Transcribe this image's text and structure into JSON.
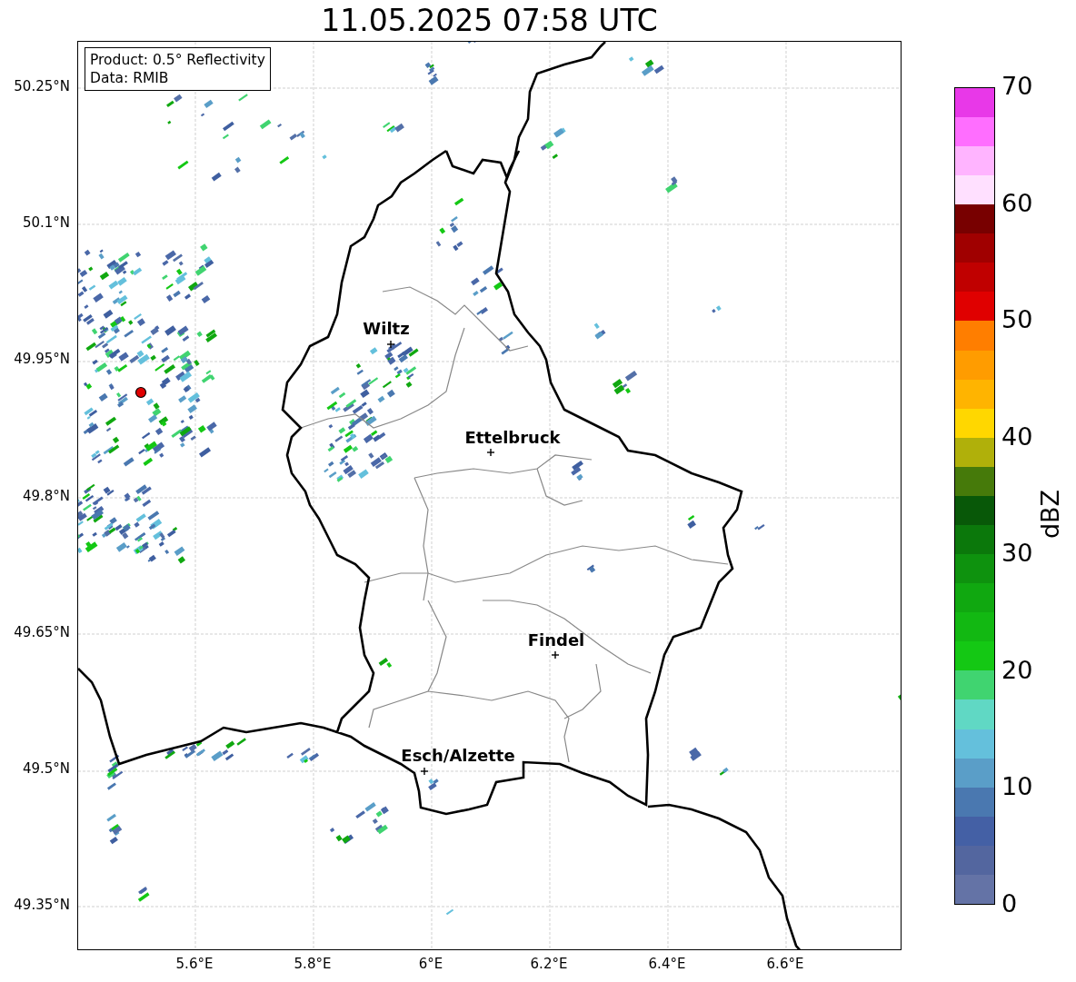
{
  "title": "11.05.2025 07:58 UTC",
  "info_box": {
    "lines": [
      "Product: 0.5° Reflectivity",
      "Data: RMIB"
    ]
  },
  "map": {
    "yticks": [
      "50.25°N",
      "50.1°N",
      "49.95°N",
      "49.8°N",
      "49.65°N",
      "49.5°N",
      "49.35°N"
    ],
    "xticks": [
      "5.6°E",
      "5.8°E",
      "6°E",
      "6.2°E",
      "6.4°E",
      "6.6°E"
    ],
    "cities": [
      {
        "name": "Wiltz"
      },
      {
        "name": "Ettelbruck"
      },
      {
        "name": "Findel"
      },
      {
        "name": "Esch/Alzette"
      }
    ]
  },
  "colorbar": {
    "label": "dBZ",
    "ticks": [
      "70",
      "60",
      "50",
      "40",
      "30",
      "20",
      "10",
      "0"
    ],
    "bins": [
      {
        "color": "#6473a6"
      },
      {
        "color": "#53669f"
      },
      {
        "color": "#4460a5"
      },
      {
        "color": "#4a78b0"
      },
      {
        "color": "#5a9ec8"
      },
      {
        "color": "#64c0dc"
      },
      {
        "color": "#60d8c4"
      },
      {
        "color": "#40d470"
      },
      {
        "color": "#14c814"
      },
      {
        "color": "#12b812"
      },
      {
        "color": "#10a810"
      },
      {
        "color": "#0e920e"
      },
      {
        "color": "#0b780b"
      },
      {
        "color": "#085808"
      },
      {
        "color": "#467a0a"
      },
      {
        "color": "#b0b00a"
      },
      {
        "color": "#ffd700"
      },
      {
        "color": "#ffb400"
      },
      {
        "color": "#ff9c00"
      },
      {
        "color": "#ff7e00"
      },
      {
        "color": "#e00000"
      },
      {
        "color": "#c00000"
      },
      {
        "color": "#a00000"
      },
      {
        "color": "#780000"
      },
      {
        "color": "#ffe0ff"
      },
      {
        "color": "#ffb4ff"
      },
      {
        "color": "#ff6eff"
      },
      {
        "color": "#e838e8"
      }
    ]
  }
}
